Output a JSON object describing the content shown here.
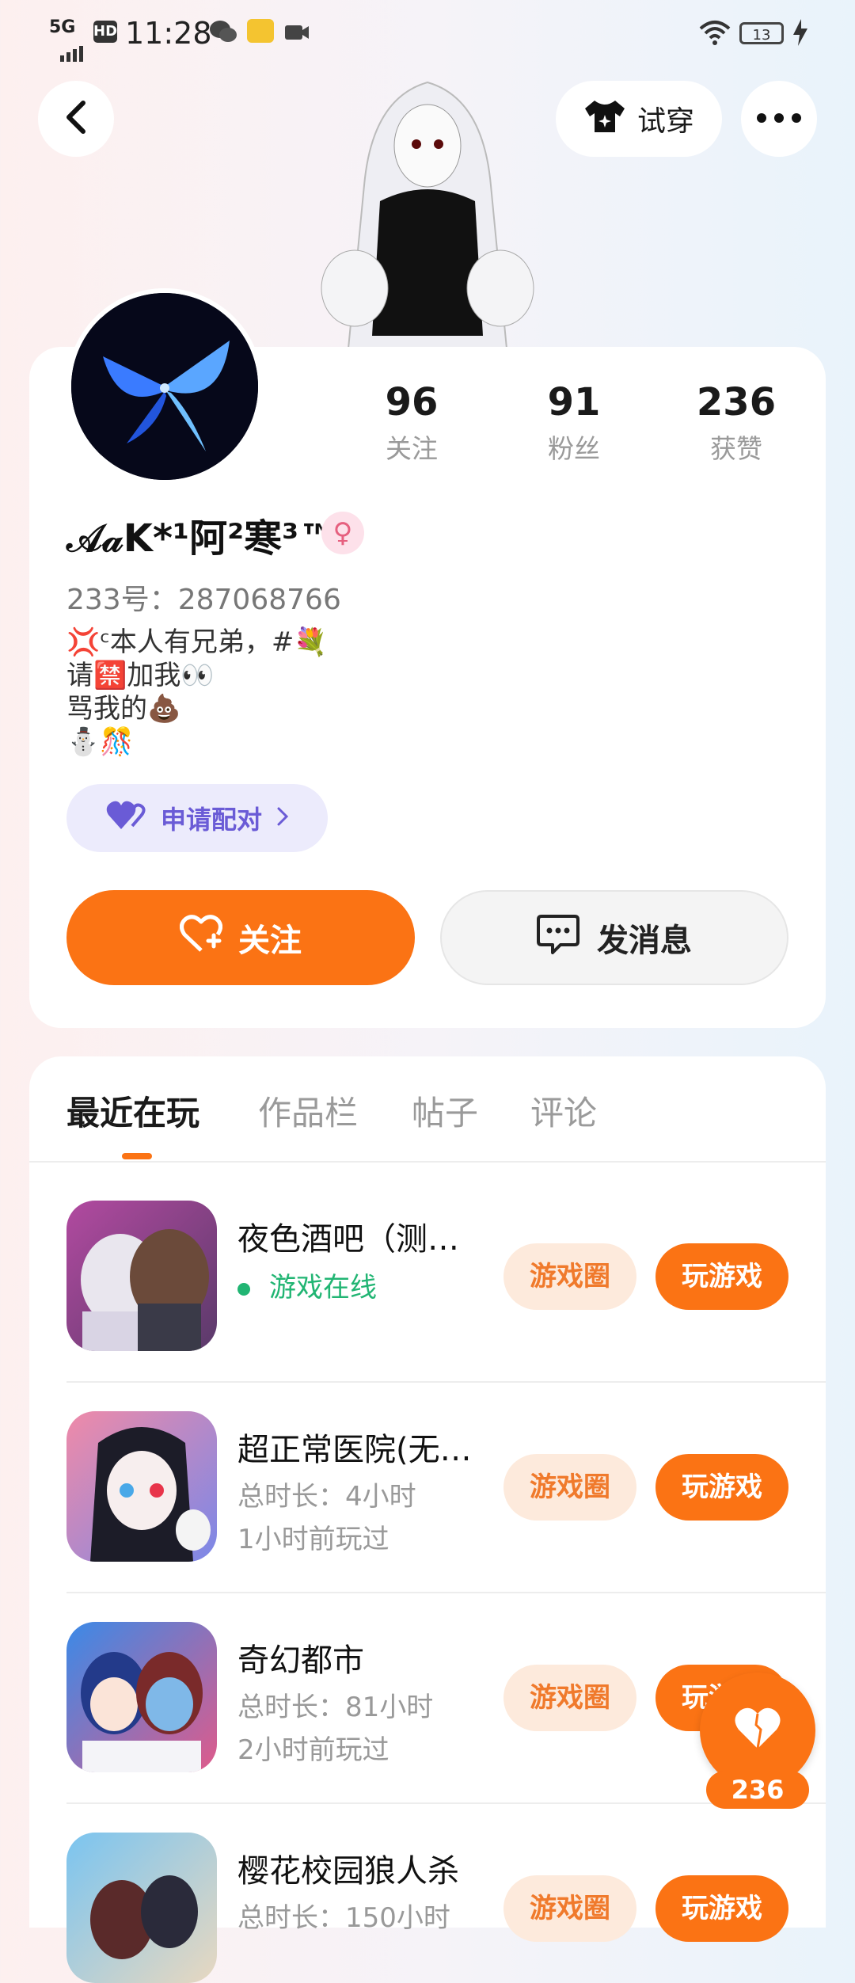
{
  "status_bar": {
    "network": "5G",
    "hd": "HD",
    "time": "11:28",
    "battery": "13"
  },
  "top_bar": {
    "try_on_label": "试穿"
  },
  "profile": {
    "stats": [
      {
        "value": "96",
        "label": "关注"
      },
      {
        "value": "91",
        "label": "粉丝"
      },
      {
        "value": "236",
        "label": "获赞"
      }
    ],
    "name": "𝒜𝒶K*¹阿²寒³™",
    "gender_symbol": "♀",
    "uid": "233号：287068766",
    "bio_lines": [
      "💢ᶜ本人有兄弟，#💐",
      "请🈲加我👀",
      "骂我的💩",
      "⛄🎊"
    ],
    "pair_label": "申请配对",
    "follow_label": "关注",
    "message_label": "发消息"
  },
  "tabs": [
    {
      "label": "最近在玩",
      "active": true
    },
    {
      "label": "作品栏",
      "active": false
    },
    {
      "label": "帖子",
      "active": false
    },
    {
      "label": "评论",
      "active": false
    }
  ],
  "games": [
    {
      "title": "夜色酒吧（测…",
      "online": "游戏在线",
      "circle_label": "游戏圈",
      "play_label": "玩游戏"
    },
    {
      "title": "超正常医院(无…",
      "duration": "总时长：4小时",
      "last_played": "1小时前玩过",
      "circle_label": "游戏圈",
      "play_label": "玩游戏"
    },
    {
      "title": "奇幻都市",
      "duration": "总时长：81小时",
      "last_played": "2小时前玩过",
      "circle_label": "游戏圈",
      "play_label": "玩游戏"
    },
    {
      "title": "樱花校园狼人杀",
      "duration": "总时长：150小时",
      "circle_label": "游戏圈",
      "play_label": "玩游戏"
    }
  ],
  "like_fab": {
    "count": "236"
  },
  "colors": {
    "accent": "#fb7314",
    "online": "#21b573",
    "pair": "#6a5bd6"
  }
}
